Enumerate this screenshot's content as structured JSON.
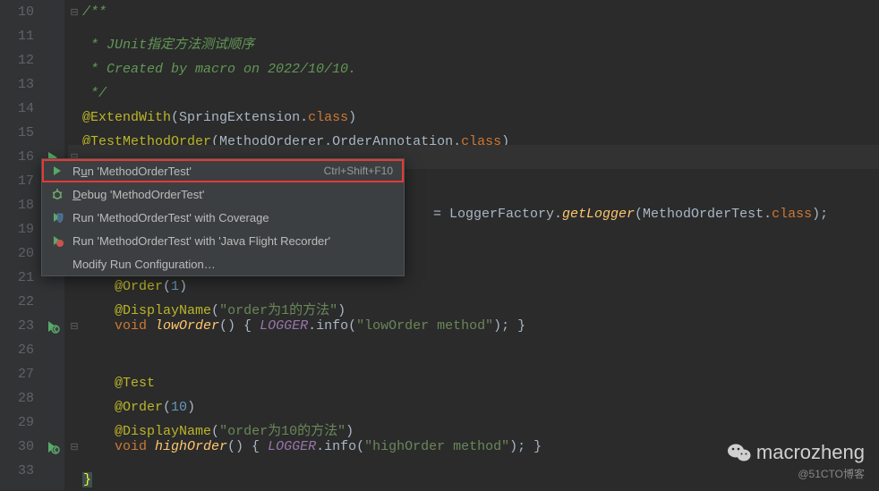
{
  "gutter": {
    "10": "10",
    "11": "11",
    "12": "12",
    "13": "13",
    "14": "14",
    "15": "15",
    "16": "16",
    "17": "17",
    "18": "18",
    "19": "19",
    "20": "20",
    "21": "21",
    "22": "22",
    "23": "23",
    "26": "26",
    "27": "27",
    "28": "28",
    "29": "29",
    "30": "30",
    "33": "33"
  },
  "code": {
    "l10": "/**",
    "l11": " * JUnit指定方法测试顺序",
    "l12": " * Created by macro on 2022/10/10.",
    "l13": " */",
    "l14_ann": "@ExtendWith",
    "l14_paren_open": "(",
    "l14_arg": "SpringExtension",
    "l14_dot": ".",
    "l14_kw": "class",
    "l14_paren_close": ")",
    "l15_ann": "@TestMethodOrder",
    "l15_arg": "MethodOrderer.OrderAnnotation",
    "l18_eq": "= LoggerFactory.",
    "l18_method": "getLogger",
    "l18_arg": "(MethodOrderTest.",
    "l18_kw": "class",
    "l18_end": ");",
    "l21_ann": "@Order",
    "l21_po": "(",
    "l21_num": "1",
    "l21_pc": ")",
    "l22_ann": "@DisplayName",
    "l22_po": "(",
    "l22_str": "\"order为1的方法\"",
    "l22_pc": ")",
    "l23_kw": "void ",
    "l23_name": "lowOrder",
    "l23_sig": "() { ",
    "l23_field": "LOGGER",
    "l23_call": ".info(",
    "l23_str": "\"lowOrder method\"",
    "l23_end": "); }",
    "l27_ann": "@Test",
    "l28_ann": "@Order",
    "l28_po": "(",
    "l28_num": "10",
    "l28_pc": ")",
    "l29_ann": "@DisplayName",
    "l29_po": "(",
    "l29_str": "\"order为10的方法\"",
    "l29_pc": ")",
    "l30_kw": "void ",
    "l30_name": "highOrder",
    "l30_sig": "() { ",
    "l30_field": "LOGGER",
    "l30_call": ".info(",
    "l30_str": "\"highOrder method\"",
    "l30_end": "); }",
    "l33_brace": "}"
  },
  "menu": {
    "run_prefix": "R",
    "run_u": "u",
    "run_suffix": "n 'MethodOrderTest'",
    "run_shortcut": "Ctrl+Shift+F10",
    "debug_u": "D",
    "debug_suffix": "ebug 'MethodOrderTest'",
    "coverage": "Run 'MethodOrderTest' with Coverage",
    "jfr": "Run 'MethodOrderTest' with 'Java Flight Recorder'",
    "modify": "Modify Run Configuration…"
  },
  "watermark": {
    "brand": "macrozheng",
    "sub": "@51CTO博客"
  }
}
